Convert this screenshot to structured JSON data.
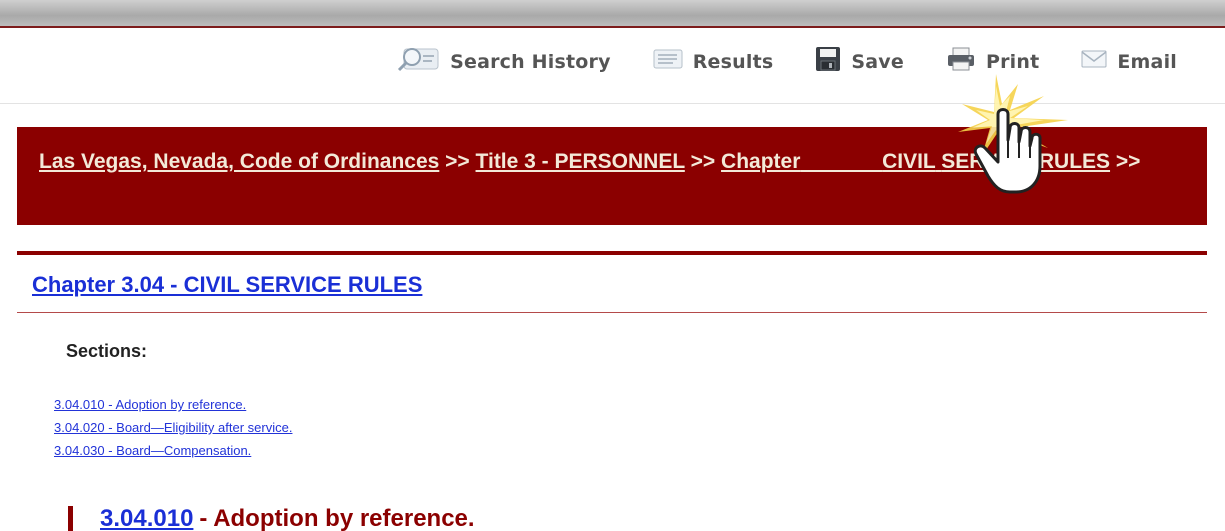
{
  "toolbar": {
    "search_history": "Search History",
    "results": "Results",
    "save": "Save",
    "print": "Print",
    "email": "Email"
  },
  "breadcrumb": {
    "item1": "Las Vegas, Nevada, Code of Ordinances",
    "sep": ">>",
    "item2": "Title 3 - PERSONNEL",
    "item3_part1": "Chapter",
    "item3_part2": "CIVIL",
    "item3_part3": "SERVICE RULES"
  },
  "chapter": {
    "title": "Chapter 3.04 - CIVIL SERVICE RULES"
  },
  "sections": {
    "label": "Sections:",
    "items": [
      "3.04.010 - Adoption by reference.",
      "3.04.020 - Board—Eligibility after service.",
      "3.04.030 - Board—Compensation."
    ]
  },
  "section_heading": {
    "number": "3.04.010",
    "rest": "- Adoption by reference."
  },
  "colors": {
    "banner": "#8b0000",
    "link": "#1a2fd6",
    "crumb_text": "#f3e9d8"
  },
  "icons": [
    "search-history-icon",
    "results-icon",
    "save-icon",
    "print-icon",
    "email-icon",
    "hand-cursor-icon"
  ]
}
